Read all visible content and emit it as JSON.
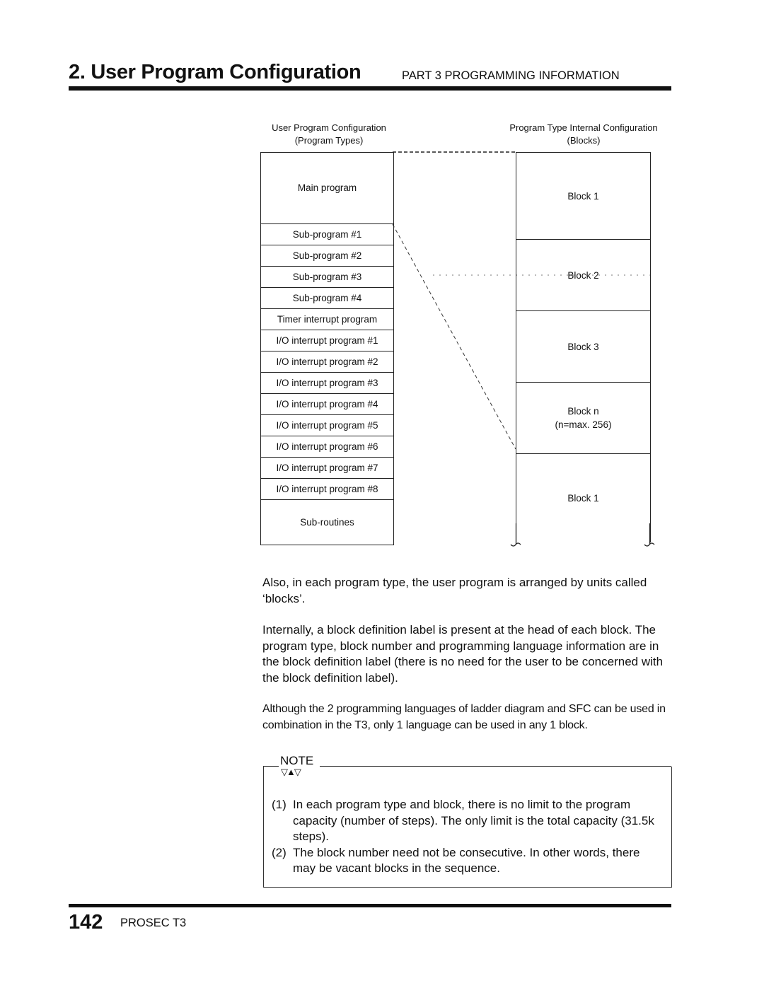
{
  "header": {
    "section_title": "2. User Program Configuration",
    "part_label": "PART 3  PROGRAMMING  INFORMATION"
  },
  "diagram": {
    "left_caption_line1": "User Program Configuration",
    "left_caption_line2": "(Program Types)",
    "right_caption_line1": "Program Type Internal Configuration",
    "right_caption_line2": "(Blocks)",
    "program_types": [
      "Main program",
      "Sub-program #1",
      "Sub-program #2",
      "Sub-program #3",
      "Sub-program #4",
      "Timer interrupt program",
      "I/O interrupt program #1",
      "I/O interrupt program #2",
      "I/O interrupt program #3",
      "I/O interrupt program #4",
      "I/O interrupt program #5",
      "I/O interrupt program #6",
      "I/O interrupt program #7",
      "I/O interrupt program #8",
      "Sub-routines"
    ],
    "blocks": [
      {
        "label": "Block 1",
        "sub": ""
      },
      {
        "label": "Block 2",
        "sub": ""
      },
      {
        "label": "Block 3",
        "sub": ""
      },
      {
        "label": "Block n",
        "sub": "(n=max.  256)"
      },
      {
        "label": "Block 1",
        "sub": ""
      }
    ]
  },
  "body": {
    "para1": "Also, in each program type, the user program is arranged by units called ‘blocks’.",
    "para2": "Internally, a block definition label is present at the head of each block. The program type, block number and programming language information are in the block definition label (there is no need for the user to be concerned with the block definition label).",
    "para3": "Although the 2 programming languages of ladder diagram and SFC can be used in combination in the T3, only 1 language can be used in any 1 block."
  },
  "note": {
    "label": "NOTE",
    "icon": "▽▲▽",
    "items": [
      {
        "num": "(1)",
        "text": "In each program type and block, there is no limit to the program capacity (number of steps). The only limit is the total capacity (31.5k steps)."
      },
      {
        "num": "(2)",
        "text": "The block number need not be consecutive.  In other words, there may be vacant blocks in the sequence."
      }
    ]
  },
  "footer": {
    "page_number": "142",
    "product": "PROSEC T3"
  }
}
